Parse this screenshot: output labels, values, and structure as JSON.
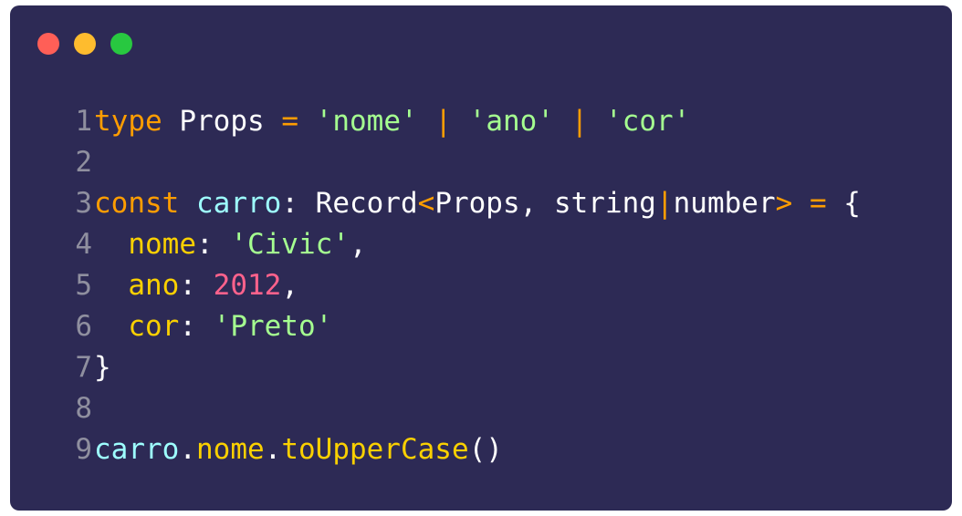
{
  "colors": {
    "window_bg": "#2d2a55",
    "line_number": "#8f8f9f",
    "keyword": "#ff9d00",
    "type": "#ffffff",
    "operator": "#ff9d00",
    "string": "#a5ff90",
    "variable": "#9effff",
    "property": "#fad000",
    "number": "#ff628c",
    "punct": "#ffffff",
    "method": "#fad000",
    "dot_red": "#ff5f57",
    "dot_yellow": "#febc2e",
    "dot_green": "#28c840"
  },
  "window_controls": [
    "close-dot",
    "minimize-dot",
    "maximize-dot"
  ],
  "code": {
    "lines": [
      {
        "n": "1",
        "tokens": [
          {
            "t": "type",
            "c": "keyword"
          },
          {
            "t": " ",
            "c": "punct"
          },
          {
            "t": "Props",
            "c": "type"
          },
          {
            "t": " ",
            "c": "punct"
          },
          {
            "t": "=",
            "c": "operator"
          },
          {
            "t": " ",
            "c": "punct"
          },
          {
            "t": "'nome'",
            "c": "string"
          },
          {
            "t": " ",
            "c": "punct"
          },
          {
            "t": "|",
            "c": "operator"
          },
          {
            "t": " ",
            "c": "punct"
          },
          {
            "t": "'ano'",
            "c": "string"
          },
          {
            "t": " ",
            "c": "punct"
          },
          {
            "t": "|",
            "c": "operator"
          },
          {
            "t": " ",
            "c": "punct"
          },
          {
            "t": "'cor'",
            "c": "string"
          }
        ]
      },
      {
        "n": "2",
        "tokens": []
      },
      {
        "n": "3",
        "tokens": [
          {
            "t": "const",
            "c": "keyword"
          },
          {
            "t": " ",
            "c": "punct"
          },
          {
            "t": "carro",
            "c": "variable"
          },
          {
            "t": ": ",
            "c": "punct"
          },
          {
            "t": "Record",
            "c": "type"
          },
          {
            "t": "<",
            "c": "operator"
          },
          {
            "t": "Props",
            "c": "type"
          },
          {
            "t": ", ",
            "c": "punct"
          },
          {
            "t": "string",
            "c": "type"
          },
          {
            "t": "|",
            "c": "operator"
          },
          {
            "t": "number",
            "c": "type"
          },
          {
            "t": ">",
            "c": "operator"
          },
          {
            "t": " ",
            "c": "punct"
          },
          {
            "t": "=",
            "c": "operator"
          },
          {
            "t": " ",
            "c": "punct"
          },
          {
            "t": "{",
            "c": "punct"
          }
        ]
      },
      {
        "n": "4",
        "tokens": [
          {
            "t": "  ",
            "c": "punct"
          },
          {
            "t": "nome",
            "c": "property"
          },
          {
            "t": ": ",
            "c": "punct"
          },
          {
            "t": "'Civic'",
            "c": "string"
          },
          {
            "t": ",",
            "c": "punct"
          }
        ]
      },
      {
        "n": "5",
        "tokens": [
          {
            "t": "  ",
            "c": "punct"
          },
          {
            "t": "ano",
            "c": "property"
          },
          {
            "t": ": ",
            "c": "punct"
          },
          {
            "t": "2012",
            "c": "number"
          },
          {
            "t": ",",
            "c": "punct"
          }
        ]
      },
      {
        "n": "6",
        "tokens": [
          {
            "t": "  ",
            "c": "punct"
          },
          {
            "t": "cor",
            "c": "property"
          },
          {
            "t": ": ",
            "c": "punct"
          },
          {
            "t": "'Preto'",
            "c": "string"
          }
        ]
      },
      {
        "n": "7",
        "tokens": [
          {
            "t": "}",
            "c": "punct"
          }
        ]
      },
      {
        "n": "8",
        "tokens": []
      },
      {
        "n": "9",
        "tokens": [
          {
            "t": "carro",
            "c": "variable"
          },
          {
            "t": ".",
            "c": "punct"
          },
          {
            "t": "nome",
            "c": "property"
          },
          {
            "t": ".",
            "c": "punct"
          },
          {
            "t": "toUpperCase",
            "c": "method"
          },
          {
            "t": "()",
            "c": "punct"
          }
        ]
      }
    ]
  }
}
